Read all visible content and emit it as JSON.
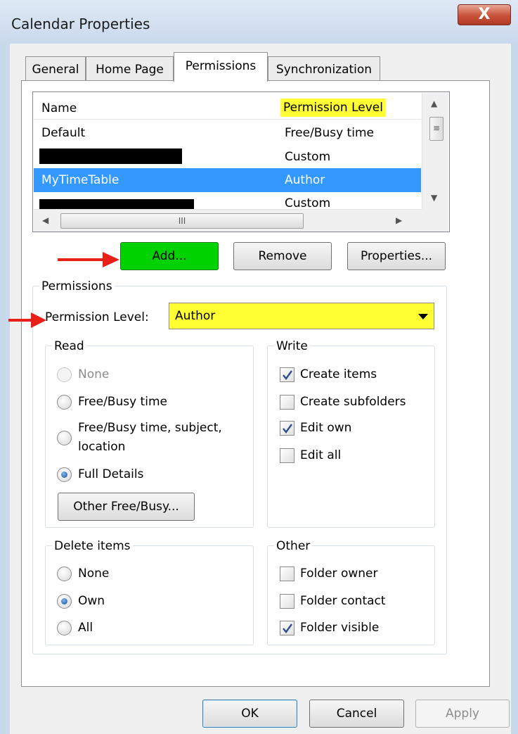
{
  "window": {
    "title": "Calendar Properties",
    "close_glyph": "X"
  },
  "tabs": [
    {
      "label": "General"
    },
    {
      "label": "Home Page"
    },
    {
      "label": "Permissions"
    },
    {
      "label": "Synchronization"
    }
  ],
  "list": {
    "columns": [
      "Name",
      "Permission Level"
    ],
    "rows": [
      {
        "name": "Default",
        "level": "Free/Busy time"
      },
      {
        "name": "",
        "level": "Custom"
      },
      {
        "name": "MyTimeTable",
        "level": "Author"
      },
      {
        "name": "",
        "level": "Custom"
      }
    ],
    "hscroll_grip": "III"
  },
  "buttons": {
    "add": "Add...",
    "remove": "Remove",
    "properties": "Properties..."
  },
  "permissions": {
    "legend": "Permissions",
    "level_label": "Permission Level:",
    "level_value": "Author",
    "read": {
      "legend": "Read",
      "options": [
        "None",
        "Free/Busy time",
        "Free/Busy time, subject,",
        "location",
        "Full Details"
      ],
      "other_button": "Other Free/Busy..."
    },
    "write": {
      "legend": "Write",
      "options": [
        "Create items",
        "Create subfolders",
        "Edit own",
        "Edit all"
      ]
    },
    "delete": {
      "legend": "Delete items",
      "options": [
        "None",
        "Own",
        "All"
      ]
    },
    "other": {
      "legend": "Other",
      "options": [
        "Folder owner",
        "Folder contact",
        "Folder visible"
      ]
    }
  },
  "footer": {
    "ok": "OK",
    "cancel": "Cancel",
    "apply": "Apply"
  },
  "colors": {
    "highlight": "#ffff33",
    "selection": "#3399ff",
    "add_button": "#00d200",
    "annotation_arrow": "#e8201a"
  }
}
